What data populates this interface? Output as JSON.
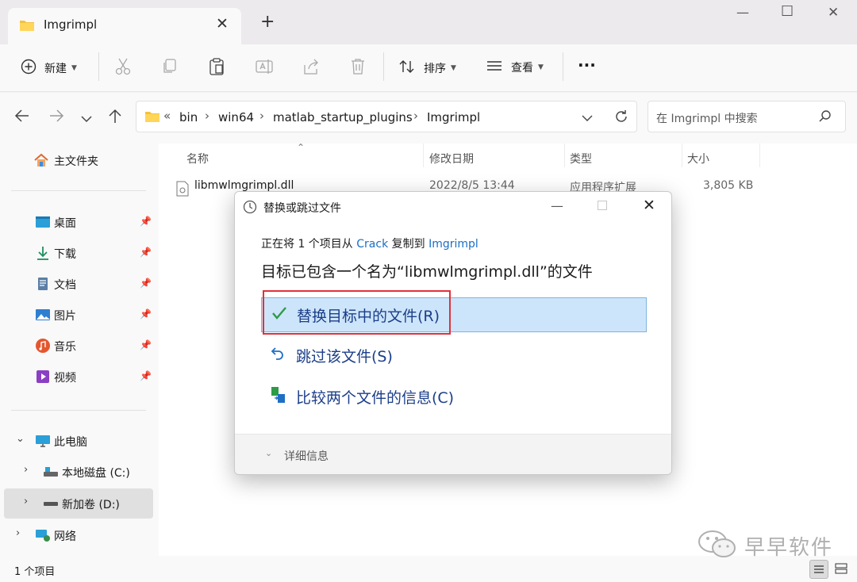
{
  "window": {
    "tab_title": "Imgrimpl",
    "tab_close": "✕",
    "new_tab": "+",
    "controls": {
      "minimize": "—",
      "maximize": "☐",
      "close": "✕"
    }
  },
  "toolbar": {
    "new_label": "新建",
    "sort_label": "排序",
    "view_label": "查看",
    "more_label": "···",
    "icons": [
      "cut-icon",
      "copy-icon",
      "paste-icon",
      "rename-icon",
      "share-icon",
      "delete-icon"
    ]
  },
  "address": {
    "overflow": "«",
    "crumbs": [
      "bin",
      "win64",
      "matlab_startup_plugins",
      "Imgrimpl"
    ],
    "separator": "›",
    "search_placeholder": "在 Imgrimpl 中搜索"
  },
  "sidebar": {
    "home": "主文件夹",
    "quick_access": [
      {
        "label": "桌面",
        "icon": "desktop-icon"
      },
      {
        "label": "下载",
        "icon": "download-icon"
      },
      {
        "label": "文档",
        "icon": "document-icon"
      },
      {
        "label": "图片",
        "icon": "pictures-icon"
      },
      {
        "label": "音乐",
        "icon": "music-icon"
      },
      {
        "label": "视频",
        "icon": "video-icon"
      }
    ],
    "this_pc": "此电脑",
    "drives": [
      {
        "label": "本地磁盘 (C:)"
      },
      {
        "label": "新加卷 (D:)"
      }
    ],
    "network": "网络"
  },
  "file_list": {
    "columns": [
      "名称",
      "修改日期",
      "类型",
      "大小"
    ],
    "rows": [
      {
        "name": "libmwlmgrimpl.dll",
        "modified": "2022/8/5 13:44",
        "type": "应用程序扩展",
        "size": "3,805 KB"
      }
    ]
  },
  "status": {
    "item_count": "1 个项目"
  },
  "watermark": {
    "text": "早早软件"
  },
  "dialog": {
    "title": "替换或跳过文件",
    "line1": {
      "prefix": "正在将 1 个项目从 ",
      "source": "Crack",
      "middle": " 复制到 ",
      "dest": "Imgrimpl"
    },
    "message": "目标已包含一个名为“libmwlmgrimpl.dll”的文件",
    "options": {
      "replace": "替换目标中的文件(R)",
      "skip": "跳过该文件(S)",
      "compare": "比较两个文件的信息(C)"
    },
    "details": "详细信息",
    "highlight_color": "#cde5fa",
    "annotation_color": "#e0313b"
  }
}
